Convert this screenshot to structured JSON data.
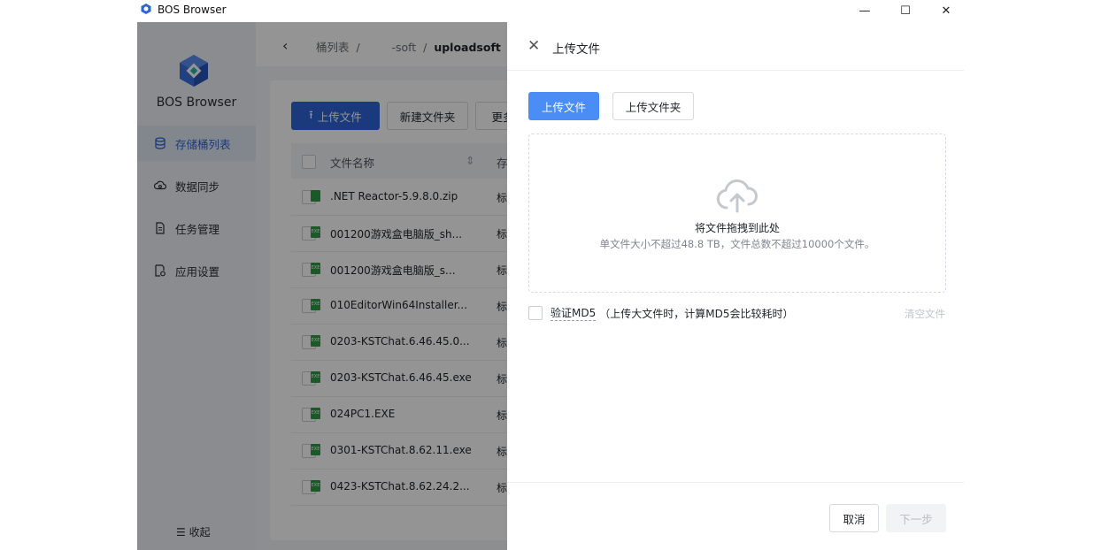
{
  "window": {
    "title": "BOS Browser",
    "minimize": "—",
    "maximize": "☐",
    "close": "✕"
  },
  "sidebar": {
    "brand": "BOS Browser",
    "items": [
      {
        "label": "存储桶列表",
        "icon": "database-icon",
        "active": true
      },
      {
        "label": "数据同步",
        "icon": "cloud-sync-icon",
        "active": false
      },
      {
        "label": "任务管理",
        "icon": "document-icon",
        "active": false
      },
      {
        "label": "应用设置",
        "icon": "settings-file-icon",
        "active": false
      }
    ],
    "collapse": "☰ 收起"
  },
  "breadcrumb": {
    "root": "桶列表",
    "bucket": "-soft",
    "folder": "uploadsoft"
  },
  "toolbar": {
    "upload": "上传文件",
    "new_folder": "新建文件夹",
    "more": "更多"
  },
  "table": {
    "headers": {
      "name": "文件名称",
      "storage": "存"
    },
    "rows": [
      {
        "name": ".NET Reactor-5.9.8.0.zip",
        "type": "标"
      },
      {
        "name": "001200游戏盒电脑版_sh...",
        "type": "标"
      },
      {
        "name": "001200游戏盒电脑版_s...",
        "type": "标"
      },
      {
        "name": "010EditorWin64Installer...",
        "type": "标"
      },
      {
        "name": "0203-KSTChat.6.46.45.0...",
        "type": "标"
      },
      {
        "name": "0203-KSTChat.6.46.45.exe",
        "type": "标"
      },
      {
        "name": "024PC1.EXE",
        "type": "标"
      },
      {
        "name": "0301-KSTChat.8.62.11.exe",
        "type": "标"
      },
      {
        "name": "0423-KSTChat.8.62.24.2...",
        "type": "标"
      }
    ]
  },
  "drawer": {
    "title": "上传文件",
    "tab_file": "上传文件",
    "tab_folder": "上传文件夹",
    "drop_title": "将文件拖拽到此处",
    "drop_hint": "单文件大小不超过48.8 TB，文件总数不超过10000个文件。",
    "md5_label": "验证MD5",
    "md5_note": "（上传大文件时，计算MD5会比较耗时）",
    "clear": "清空文件",
    "cancel": "取消",
    "next": "下一步"
  }
}
